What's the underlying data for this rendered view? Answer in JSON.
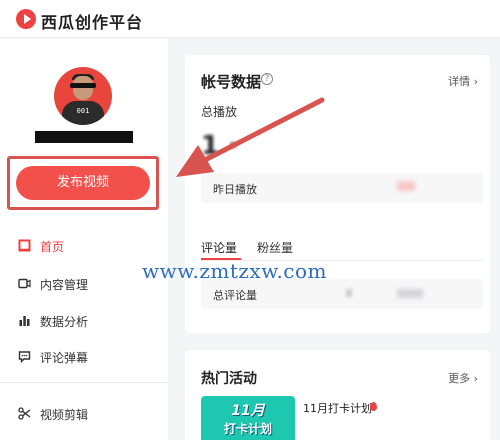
{
  "app": {
    "title": "西瓜创作平台"
  },
  "sidebar": {
    "avatar_shirt_text": "001",
    "publish_label": "发布视频",
    "items": [
      {
        "label": "首页",
        "icon": "home-icon",
        "active": true
      },
      {
        "label": "内容管理",
        "icon": "video-icon"
      },
      {
        "label": "数据分析",
        "icon": "bar-chart-icon"
      },
      {
        "label": "评论弹幕",
        "icon": "comment-icon"
      },
      {
        "label": "视频剪辑",
        "icon": "scissors-icon"
      }
    ]
  },
  "account_data": {
    "title": "帐号数据",
    "help": "?",
    "detail_link": "详情 ›",
    "total_play_label": "总播放",
    "total_play_value": "1 ·",
    "yesterday_label": "昨日播放",
    "tabs": [
      "评论量",
      "粉丝量"
    ],
    "total_comments_label": "总评论量"
  },
  "hot_events": {
    "title": "热门活动",
    "more_link": "更多 ›",
    "event_title": "11月打卡计划",
    "thumb_line1": "11月",
    "thumb_line2": "打卡计划"
  },
  "watermark": "www.zmtzxw.com",
  "colors": {
    "accent": "#f04142",
    "annotation_red": "#d9534f",
    "watermark_blue": "#2d6cc0"
  }
}
